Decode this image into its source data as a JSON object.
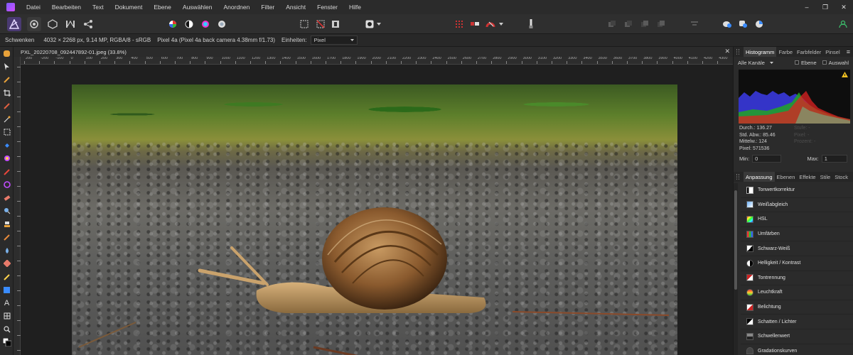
{
  "menu": {
    "items": [
      "Datei",
      "Bearbeiten",
      "Text",
      "Dokument",
      "Ebene",
      "Auswählen",
      "Anordnen",
      "Filter",
      "Ansicht",
      "Fenster",
      "Hilfe"
    ],
    "window_controls": [
      "–",
      "❐",
      "✕"
    ]
  },
  "context_bar": {
    "tool": "Schwenken",
    "image_info": "4032 × 2268 px, 9.14 MP, RGBA/8 - sRGB",
    "camera": "Pixel 4a (Pixel 4a back camera 4.38mm f/1.73)",
    "units_label": "Einheiten:",
    "units_value": "Pixel"
  },
  "document": {
    "tab_title": "PXL_20220708_092447892-01.jpeg (33.8%)",
    "ruler_ticks": [
      "200",
      "-200",
      "-100",
      "0",
      "100",
      "200",
      "300",
      "400",
      "500",
      "600",
      "700",
      "800",
      "900",
      "1000",
      "1100",
      "1200",
      "1300",
      "1400",
      "1500",
      "1600",
      "1700",
      "1800",
      "1900",
      "2000",
      "2100",
      "2200",
      "2300",
      "2400",
      "2500",
      "2600",
      "2700",
      "2800",
      "2900",
      "3000",
      "3100",
      "3200",
      "3300",
      "3400",
      "3500",
      "3600",
      "3700",
      "3800",
      "3900",
      "4000",
      "4100",
      "4200",
      "4300"
    ]
  },
  "histogram_panel": {
    "tabs": [
      "Histogramm",
      "Farbe",
      "Farbfelder",
      "Pinsel"
    ],
    "channel": "Alle Kanäle",
    "checkbox_layer": "Ebene",
    "checkbox_selection": "Auswahl",
    "stats": [
      "Durch.: 136.27",
      "Std. Abw.: 85.46",
      "Mittelw.: 124",
      "Pixel: 571536"
    ],
    "stats_faded": [
      "Stufe: -",
      "Pixel: -",
      "Prozent: -"
    ],
    "min_label": "Min:",
    "min_value": "0",
    "max_label": "Max:",
    "max_value": "1",
    "warning_color": "#f0c020"
  },
  "adjust_panel": {
    "tabs": [
      "Anpassung",
      "Ebenen",
      "Effekte",
      "Stile",
      "Stock"
    ],
    "items": [
      {
        "label": "Tonwertkorrektur",
        "icon": "levels-icon"
      },
      {
        "label": "Weißabgleich",
        "icon": "white-balance-icon"
      },
      {
        "label": "HSL",
        "icon": "hsl-icon"
      },
      {
        "label": "Umfärben",
        "icon": "recolor-icon"
      },
      {
        "label": "Schwarz-Weiß",
        "icon": "black-white-icon"
      },
      {
        "label": "Helligkeit / Kontrast",
        "icon": "brightness-contrast-icon"
      },
      {
        "label": "Tontrennung",
        "icon": "posterize-icon"
      },
      {
        "label": "Leuchtkraft",
        "icon": "vibrance-icon"
      },
      {
        "label": "Belichtung",
        "icon": "exposure-icon"
      },
      {
        "label": "Schatten / Lichter",
        "icon": "shadows-highlights-icon"
      },
      {
        "label": "Schwellenwert",
        "icon": "threshold-icon"
      },
      {
        "label": "Gradationskurven",
        "icon": "curves-icon"
      }
    ]
  },
  "colors": {
    "accent": "#6a4cc8",
    "panel_bg": "#2b2b2b",
    "menubar_bg": "#2b2b2b"
  }
}
